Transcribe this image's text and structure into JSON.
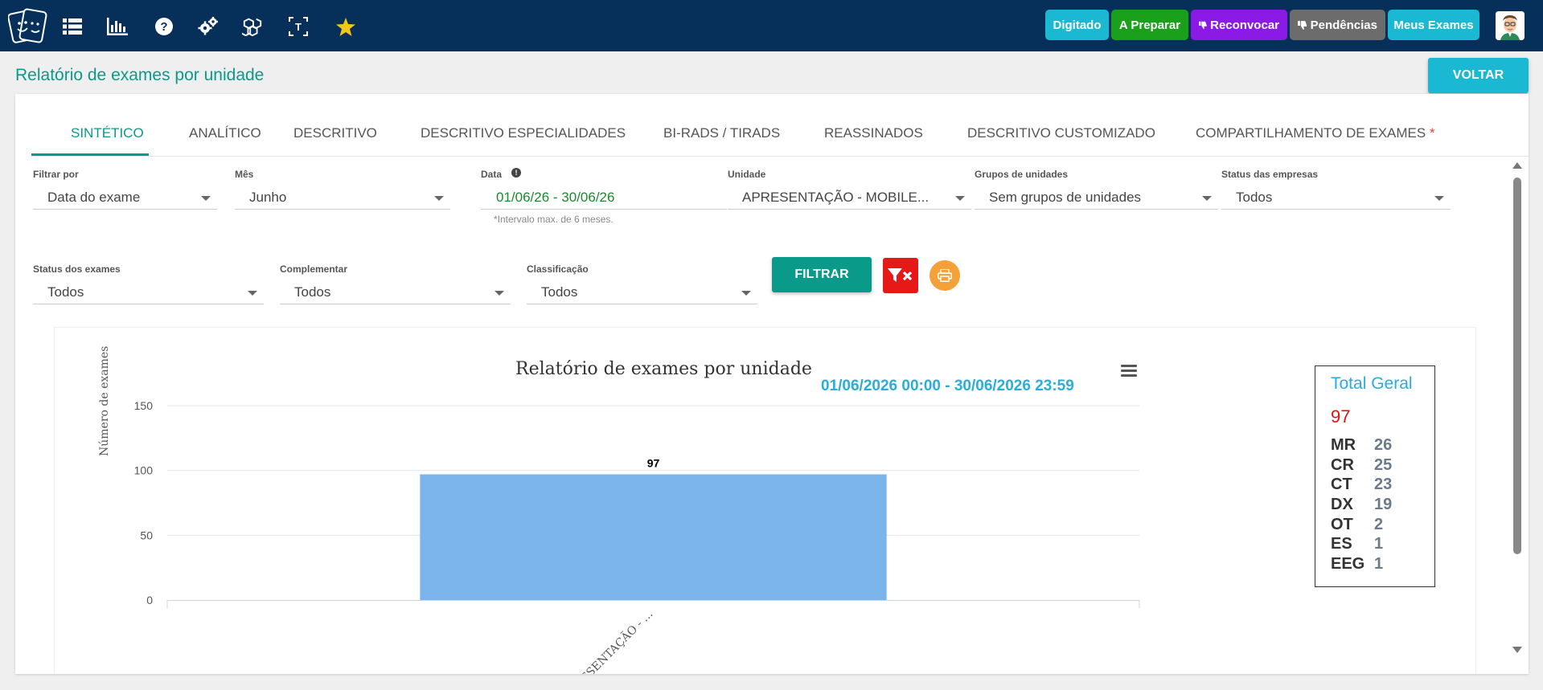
{
  "topbar": {
    "nav_icons": [
      "list-icon",
      "bar-chart-icon",
      "help-icon",
      "settings-icon",
      "cubes-icon",
      "text-select-icon",
      "star-icon"
    ],
    "pills": [
      {
        "label": "Digitado",
        "color": "#1bb8d4"
      },
      {
        "label": "A Preparar",
        "color": "#1aa01a"
      },
      {
        "label": "Reconvocar",
        "color": "#8b1ae6"
      },
      {
        "label": "Pendências",
        "color": "#6c6c6c"
      },
      {
        "label": "Meus Exames",
        "color": "#1bb8d4"
      }
    ]
  },
  "page": {
    "title": "Relatório de exames por unidade",
    "back_label": "VOLTAR"
  },
  "tabs": [
    {
      "label": "SINTÉTICO",
      "active": true
    },
    {
      "label": "ANALÍTICO"
    },
    {
      "label": "DESCRITIVO"
    },
    {
      "label": "DESCRITIVO ESPECIALIDADES"
    },
    {
      "label": "BI-RADS / TIRADS"
    },
    {
      "label": "REASSINADOS"
    },
    {
      "label": "DESCRITIVO CUSTOMIZADO"
    },
    {
      "label": "COMPARTILHAMENTO DE EXAMES",
      "required_mark": "*"
    }
  ],
  "filters": {
    "filtrar_por": {
      "label": "Filtrar por",
      "value": "Data do exame"
    },
    "mes": {
      "label": "Mês",
      "value": "Junho"
    },
    "data": {
      "label": "Data",
      "value": "01/06/26 - 30/06/26",
      "hint": "*Intervalo max. de 6 meses."
    },
    "unidade": {
      "label": "Unidade",
      "value": "APRESENTAÇÃO - MOBILE..."
    },
    "grupos": {
      "label": "Grupos de unidades",
      "value": "Sem grupos de unidades"
    },
    "status_empresas": {
      "label": "Status das empresas",
      "value": "Todos"
    },
    "status_exames": {
      "label": "Status dos exames",
      "value": "Todos"
    },
    "complementar": {
      "label": "Complementar",
      "value": "Todos"
    },
    "classificacao": {
      "label": "Classificação",
      "value": "Todos"
    },
    "filter_button": "FILTRAR"
  },
  "chart_data": {
    "type": "bar",
    "title": "Relatório de exames por unidade",
    "subtitle": "01/06/2026 00:00 - 30/06/2026 23:59",
    "ylabel": "Número de exames",
    "xlabel": "",
    "categories": [
      "APRESENTAÇÃO - ..."
    ],
    "values": [
      97
    ],
    "data_labels": [
      "97"
    ],
    "ylim": [
      0,
      150
    ],
    "yticks": [
      0,
      50,
      100,
      150
    ],
    "bar_color": "#7cb5ec",
    "grid": true
  },
  "totals": {
    "title": "Total Geral",
    "value": "97",
    "items": [
      {
        "code": "MR",
        "count": "26"
      },
      {
        "code": "CR",
        "count": "25"
      },
      {
        "code": "CT",
        "count": "23"
      },
      {
        "code": "DX",
        "count": "19"
      },
      {
        "code": "OT",
        "count": "2"
      },
      {
        "code": "ES",
        "count": "1"
      },
      {
        "code": "EEG",
        "count": "1"
      }
    ]
  }
}
